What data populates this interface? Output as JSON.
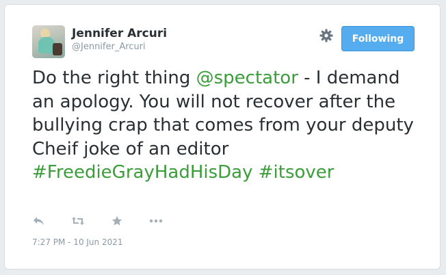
{
  "user": {
    "display_name": "Jennifer Arcuri",
    "handle": "@Jennifer_Arcuri"
  },
  "header": {
    "follow_button_label": "Following",
    "gear_icon": "gear-icon"
  },
  "tweet": {
    "segments": [
      {
        "text": "Do the right thing ",
        "type": "text"
      },
      {
        "text": "@spectator",
        "type": "mention"
      },
      {
        "text": " - I demand an apology. You will not recover after the bullying crap that comes from your deputy Cheif joke of an editor ",
        "type": "text"
      },
      {
        "text": "#FreedieGrayHadHisDay",
        "type": "hashtag"
      },
      {
        "text": " ",
        "type": "text"
      },
      {
        "text": "#itsover",
        "type": "hashtag"
      }
    ],
    "timestamp": "7:27 PM - 10 Jun 2021"
  },
  "actions": [
    "reply-icon",
    "retweet-icon",
    "favorite-icon",
    "more-icon"
  ],
  "colors": {
    "link": "#3a9d3a",
    "button": "#55acee",
    "text": "#292f33",
    "muted": "#8899a6"
  }
}
